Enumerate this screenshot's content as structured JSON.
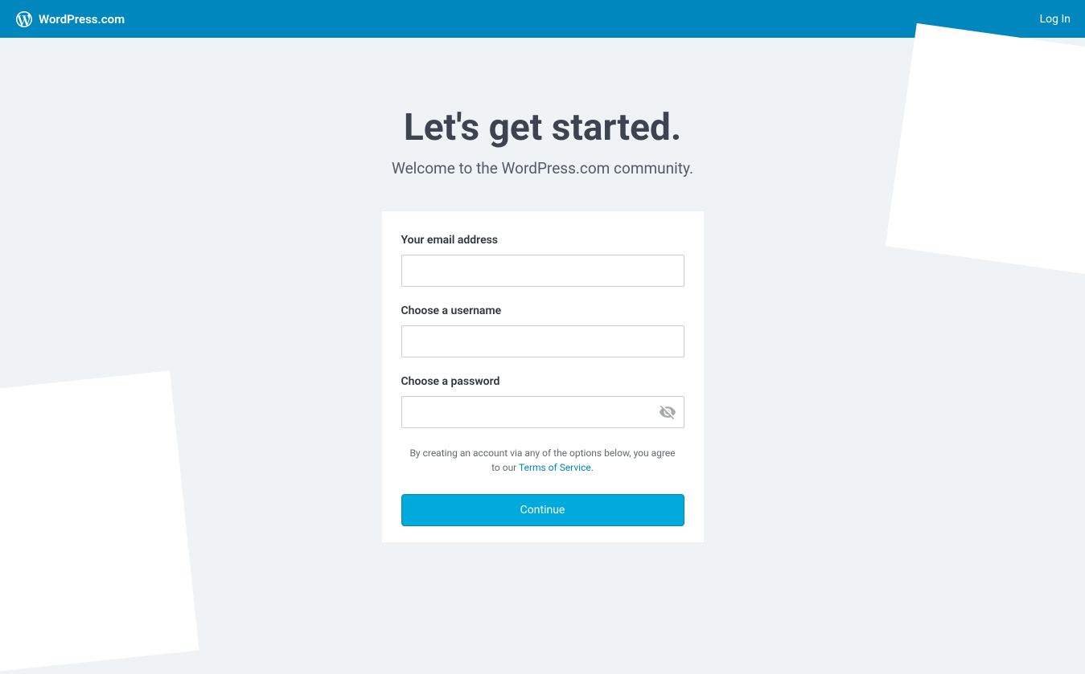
{
  "header": {
    "brand": "WordPress.com",
    "login_link": "Log In"
  },
  "page": {
    "title": "Let's get started.",
    "subtitle": "Welcome to the WordPress.com community."
  },
  "form": {
    "email_label": "Your email address",
    "email_value": "",
    "username_label": "Choose a username",
    "username_value": "",
    "password_label": "Choose a password",
    "password_value": "",
    "tos_text_before": "By creating an account via any of the options below, you agree to our ",
    "tos_link": "Terms of Service",
    "tos_text_after": ".",
    "continue_label": "Continue"
  }
}
